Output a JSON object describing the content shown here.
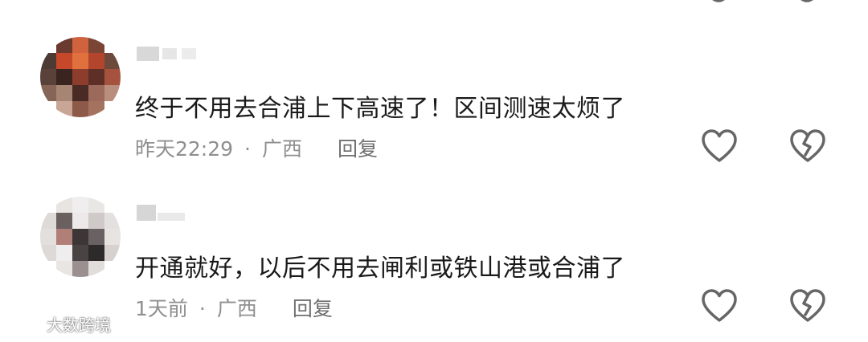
{
  "comments": [
    {
      "text": "终于不用去合浦上下高速了！区间测速太烦了",
      "time": "昨天22:29",
      "separator": "·",
      "location": "广西",
      "reply_label": "回复",
      "like_icon": "heart-outline-icon",
      "dislike_icon": "broken-heart-icon"
    },
    {
      "text": "开通就好，以后不用去闸利或铁山港或合浦了",
      "time": "1天前",
      "separator": "·",
      "location": "广西",
      "reply_label": "回复",
      "like_icon": "heart-outline-icon",
      "dislike_icon": "broken-heart-icon"
    }
  ],
  "watermark": {
    "text": "大数跨境"
  },
  "colors": {
    "text_primary": "#1a1a1a",
    "text_meta": "#8f8f8f",
    "icon_stroke": "#666666",
    "background": "#ffffff"
  }
}
